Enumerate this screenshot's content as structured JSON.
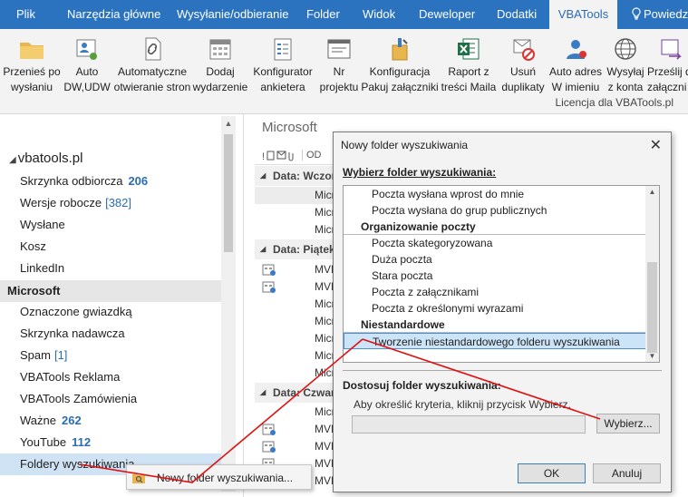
{
  "tabs": [
    {
      "label": "Plik"
    },
    {
      "label": "Narzędzia główne"
    },
    {
      "label": "Wysyłanie/odbieranie"
    },
    {
      "label": "Folder"
    },
    {
      "label": "Widok"
    },
    {
      "label": "Deweloper"
    },
    {
      "label": "Dodatki"
    },
    {
      "label": "VBATools"
    },
    {
      "label": "Powiedz"
    }
  ],
  "ribbon": {
    "buttons": [
      {
        "line1": "Przenieś po",
        "line2": "wysłaniu",
        "icon": "folder-move-icon"
      },
      {
        "line1": "Auto",
        "line2": "DW,UDW",
        "icon": "contact-card-icon"
      },
      {
        "line1": "Automatyczne",
        "line2": "otwieranie stron",
        "icon": "link-document-icon"
      },
      {
        "line1": "Dodaj",
        "line2": "wydarzenie",
        "icon": "calendar-icon"
      },
      {
        "line1": "Konfigurator",
        "line2": "ankietera",
        "icon": "survey-icon"
      },
      {
        "line1": "Nr",
        "line2": "projektu",
        "icon": "window-icon"
      },
      {
        "line1": "Konfiguracja",
        "line2": "Pakuj załączniki",
        "icon": "package-icon"
      },
      {
        "line1": "Raport z",
        "line2": "treści Maila",
        "icon": "excel-icon"
      },
      {
        "line1": "Usuń",
        "line2": "duplikaty",
        "icon": "delete-duplicates-icon"
      },
      {
        "line1": "Auto adres",
        "line2": "W imieniu",
        "icon": "person-icon"
      },
      {
        "line1": "Wysyłaj",
        "line2": "z konta",
        "icon": "globe-icon"
      },
      {
        "line1": "Prześlij d",
        "line2": "załączni",
        "icon": "forward-icon"
      }
    ],
    "licence": "Licencja dla VBATools.pl"
  },
  "sidebar": {
    "account": "vbatools.pl",
    "folders": [
      {
        "label": "Skrzynka odbiorcza",
        "count": "206"
      },
      {
        "label": "Wersje robocze",
        "count_b": "[382]"
      },
      {
        "label": "Wysłane"
      },
      {
        "label": "Kosz"
      },
      {
        "label": "LinkedIn"
      },
      {
        "label": "Microsoft"
      },
      {
        "label": "Oznaczone gwiazdką"
      },
      {
        "label": "Skrzynka nadawcza"
      },
      {
        "label": "Spam",
        "count_b": "[1]"
      },
      {
        "label": "VBATools Reklama"
      },
      {
        "label": "VBATools Zamówienia"
      },
      {
        "label": "Ważne",
        "count": "262"
      },
      {
        "label": "YouTube",
        "count": "112"
      },
      {
        "label": "Foldery wyszukiwania"
      }
    ]
  },
  "maillist": {
    "title": "Microsoft",
    "header_od": "OD",
    "group1": "Data: Wczora",
    "group2": "Data: Piątek",
    "group3": "Data: Czwart",
    "row_text_a": "Micr",
    "row_text_b": "MVF"
  },
  "dialog": {
    "title": "Nowy folder wyszukiwania",
    "choose_label": "Wybierz folder wyszukiwania:",
    "items": [
      {
        "kind": "item",
        "label": "Poczta wysłana wprost do mnie"
      },
      {
        "kind": "item",
        "label": "Poczta wysłana do grup publicznych"
      },
      {
        "kind": "header",
        "label": "Organizowanie poczty"
      },
      {
        "kind": "item",
        "label": "Poczta skategoryzowana"
      },
      {
        "kind": "item",
        "label": "Duża poczta"
      },
      {
        "kind": "item",
        "label": "Stara poczta"
      },
      {
        "kind": "item",
        "label": "Poczta z załącznikami"
      },
      {
        "kind": "item",
        "label": "Poczta z określonymi wyrazami"
      },
      {
        "kind": "header",
        "label": "Niestandardowe"
      },
      {
        "kind": "item",
        "label": "Tworzenie niestandardowego folderu wyszukiwania",
        "selected": true
      }
    ],
    "customize_label": "Dostosuj folder wyszukiwania:",
    "hint": "Aby określić kryteria, kliknij przycisk Wybierz.",
    "choose_btn": "Wybierz...",
    "ok_btn": "OK",
    "cancel_btn": "Anuluj"
  },
  "context_menu": {
    "item": "Nowy folder wyszukiwania..."
  },
  "colors": {
    "accent": "#2b73bf",
    "selection": "#cce4f7",
    "arrow": "#e01010"
  }
}
